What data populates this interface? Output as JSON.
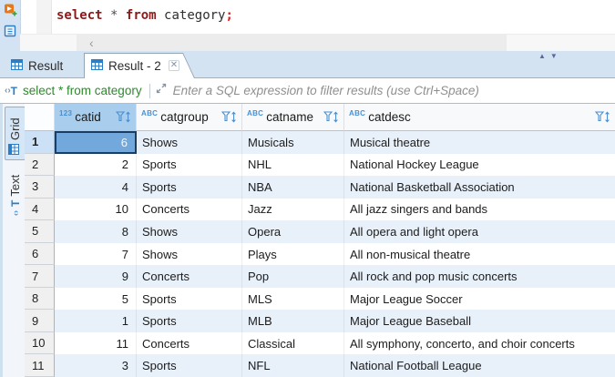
{
  "colors": {
    "accent_blue": "#2e7cc3",
    "selection_blue": "#72a8dc",
    "selection_border": "#1c3c60",
    "header_selected": "#a9cdec",
    "row_alt": "#e8f1fa",
    "tabbar_bg": "#d3e3f2",
    "filter_green": "#2d8a2d",
    "keyword_red": "#8b1a1a",
    "semicolon_red": "#e31b1b"
  },
  "editor": {
    "sql": {
      "kw1": "select",
      "star": "*",
      "kw2": "from",
      "table": "category",
      "semi": ";"
    },
    "scroll_chevron": "‹"
  },
  "nav": {
    "up": "▲",
    "down": "▼"
  },
  "result_tabs": {
    "tab1": {
      "label": "Result"
    },
    "tab2": {
      "label": "Result - 2",
      "close": "✕"
    }
  },
  "filter": {
    "icon_angle": "‹›",
    "icon_t": "T",
    "query": "select * from category",
    "placeholder": "Enter a SQL expression to filter results (use Ctrl+Space)"
  },
  "side_tabs": {
    "grid": "Grid",
    "text": "Text",
    "text_icon_angle": "‹›",
    "text_icon_t": "T"
  },
  "grid": {
    "columns": [
      {
        "type": "123",
        "name": "catid"
      },
      {
        "type": "ABC",
        "name": "catgroup"
      },
      {
        "type": "ABC",
        "name": "catname"
      },
      {
        "type": "ABC",
        "name": "catdesc"
      }
    ],
    "selected": {
      "row": 1,
      "column": "catid"
    },
    "rows": [
      [
        "1",
        "6",
        "Shows",
        "Musicals",
        "Musical theatre"
      ],
      [
        "2",
        "2",
        "Sports",
        "NHL",
        "National Hockey League"
      ],
      [
        "3",
        "4",
        "Sports",
        "NBA",
        "National Basketball Association"
      ],
      [
        "4",
        "10",
        "Concerts",
        "Jazz",
        "All jazz singers and bands"
      ],
      [
        "5",
        "8",
        "Shows",
        "Opera",
        "All opera and light opera"
      ],
      [
        "6",
        "7",
        "Shows",
        "Plays",
        "All non-musical theatre"
      ],
      [
        "7",
        "9",
        "Concerts",
        "Pop",
        "All rock and pop music concerts"
      ],
      [
        "8",
        "5",
        "Sports",
        "MLS",
        "Major League Soccer"
      ],
      [
        "9",
        "1",
        "Sports",
        "MLB",
        "Major League Baseball"
      ],
      [
        "10",
        "11",
        "Concerts",
        "Classical",
        "All symphony, concerto, and choir concerts"
      ],
      [
        "11",
        "3",
        "Sports",
        "NFL",
        "National Football League"
      ]
    ]
  }
}
